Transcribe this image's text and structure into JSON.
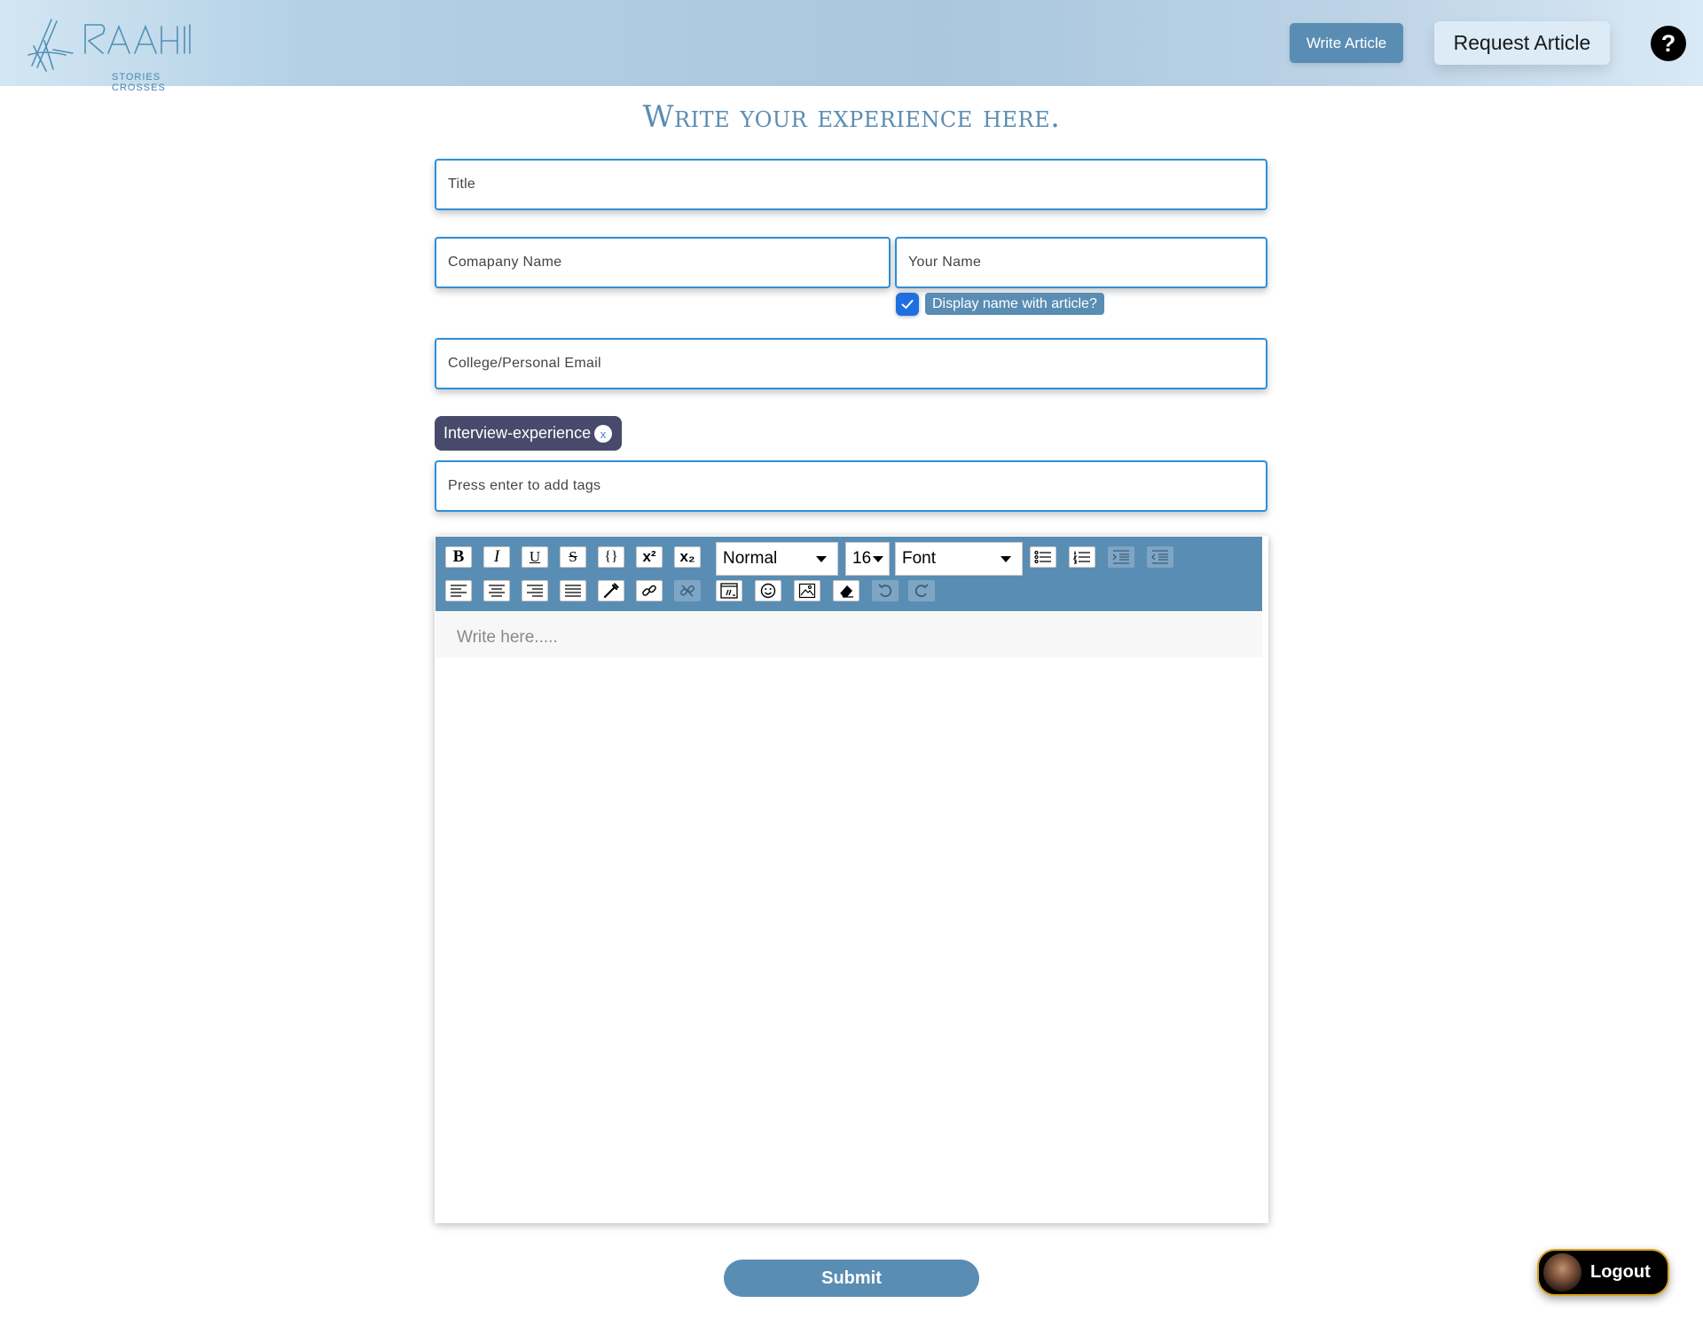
{
  "header": {
    "logo_text": "RAAHI",
    "logo_tagline": "STORIES CROSSES",
    "write_article_label": "Write Article",
    "request_article_label": "Request Article",
    "help_label": "?"
  },
  "page": {
    "title": "Write your experience here."
  },
  "form": {
    "title_placeholder": "Title",
    "company_placeholder": "Comapany Name",
    "name_placeholder": "Your Name",
    "display_name_label": "Display name with article?",
    "display_name_checked": true,
    "email_placeholder": "College/Personal Email",
    "tags": [
      {
        "label": "Interview-experience",
        "remove": "x"
      }
    ],
    "tags_placeholder": "Press enter to add tags"
  },
  "editor": {
    "toolbar": {
      "bold": "B",
      "italic": "I",
      "underline": "U",
      "strike": "S",
      "code": "{}",
      "superscript": "x²",
      "subscript": "x₂",
      "block_type": "Normal",
      "font_size": "16",
      "font_family": "Font"
    },
    "placeholder": "Write here....."
  },
  "actions": {
    "submit_label": "Submit",
    "logout_label": "Logout"
  },
  "colors": {
    "accent": "#5a8db3",
    "input_border": "#2f8fd8",
    "tag_bg": "#474a6a",
    "check": "#1f6fe0",
    "logout_border": "#d9a21b"
  }
}
